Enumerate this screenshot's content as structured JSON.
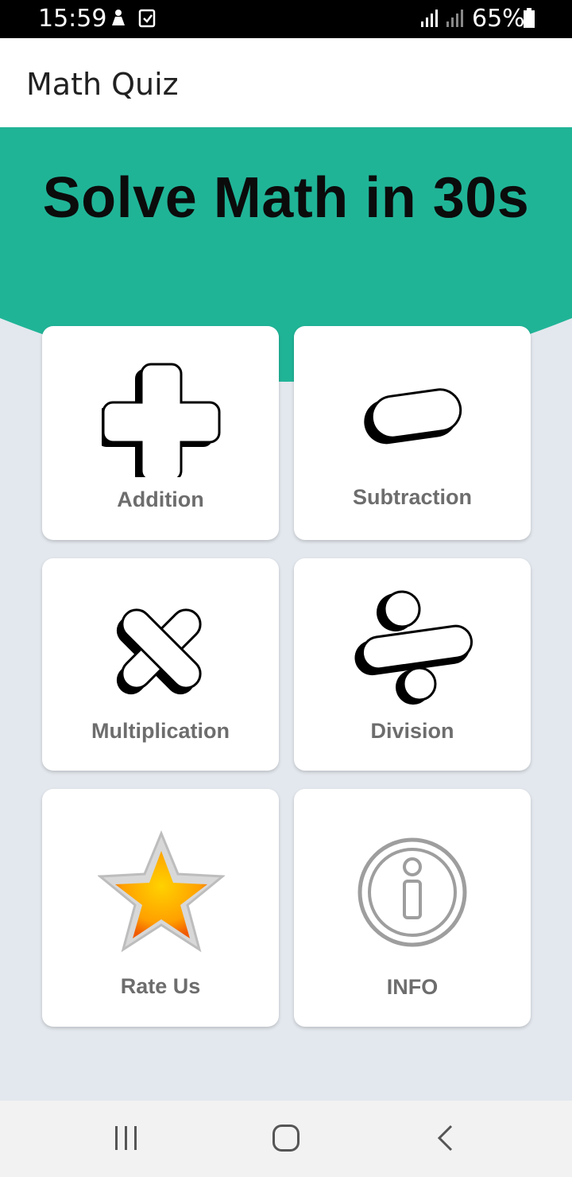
{
  "status_bar": {
    "time": "15:59",
    "battery": "65%"
  },
  "app_bar": {
    "title": "Math Quiz"
  },
  "hero": {
    "headline": "Solve Math in 30s",
    "color": "#20b497"
  },
  "cards": {
    "addition": {
      "label": "Addition",
      "icon": "plus-icon"
    },
    "subtraction": {
      "label": "Subtraction",
      "icon": "minus-icon"
    },
    "multiplication": {
      "label": "Multiplication",
      "icon": "multiply-icon"
    },
    "division": {
      "label": "Division",
      "icon": "divide-icon"
    },
    "rate": {
      "label": "Rate Us",
      "icon": "star-icon"
    },
    "info": {
      "label": "INFO",
      "icon": "info-icon"
    }
  },
  "nav": {
    "recents": "recents-icon",
    "home": "home-icon",
    "back": "back-icon"
  }
}
